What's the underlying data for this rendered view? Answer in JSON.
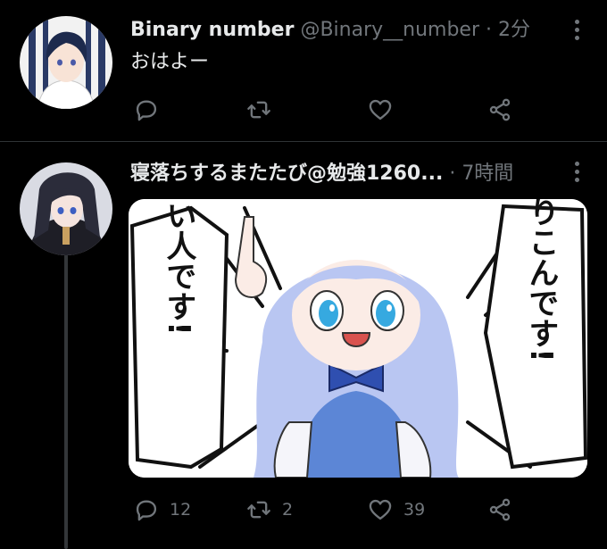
{
  "tweets": [
    {
      "name": "Binary number",
      "handle": "@Binary__number",
      "separator": "·",
      "time": "2分",
      "text": "おはよー",
      "counts": {
        "reply": "",
        "retweet": "",
        "like": ""
      }
    },
    {
      "name": "寝落ちするまたたび@勉強1260...",
      "handle": "",
      "separator": "·",
      "time": "7時間",
      "text": "",
      "media_text": {
        "left": "あぶない人です!",
        "right": "この人ろりこんです!"
      },
      "counts": {
        "reply": "12",
        "retweet": "2",
        "like": "39"
      }
    }
  ],
  "colors": {
    "background": "#000000",
    "text": "#e7e9ea",
    "secondary": "#71767b",
    "divider": "#2f3336"
  },
  "icons": {
    "reply": "reply-icon",
    "retweet": "retweet-icon",
    "like": "like-icon",
    "share": "share-icon",
    "more": "more-icon"
  }
}
